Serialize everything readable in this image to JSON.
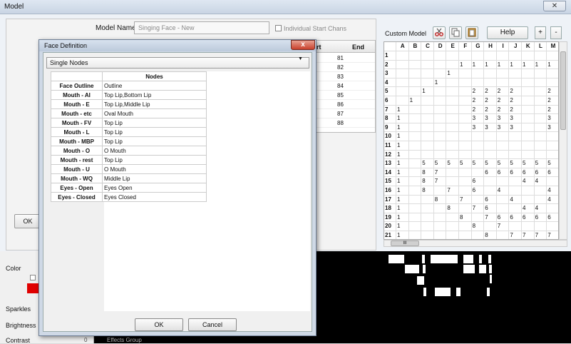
{
  "window": {
    "title": "Model",
    "close_icon": "close-icon"
  },
  "model": {
    "name_label": "Model Name",
    "name_value": "Singing Face - New",
    "individual_start_chans_label": "Individual Start Chans",
    "table_header_start": "art",
    "table_header_end": "End",
    "table_end_values": [
      "81",
      "82",
      "83",
      "84",
      "85",
      "86",
      "87",
      "88"
    ],
    "ok_button_label": "OK"
  },
  "custom_model": {
    "label": "Custom Model",
    "help_label": "Help",
    "plus_label": "+",
    "minus_label": "-",
    "icons": [
      "cut-icon",
      "copy-icon",
      "paste-icon"
    ],
    "columns": [
      "A",
      "B",
      "C",
      "D",
      "E",
      "F",
      "G",
      "H",
      "I",
      "J",
      "K",
      "L",
      "M"
    ],
    "rows": [
      {
        "n": "1",
        "cells": [
          "",
          "",
          "",
          "",
          "",
          "",
          "",
          "",
          "",
          "",
          "",
          "",
          ""
        ]
      },
      {
        "n": "2",
        "cells": [
          "",
          "",
          "",
          "",
          "",
          "1",
          "1",
          "1",
          "1",
          "1",
          "1",
          "1",
          "1"
        ]
      },
      {
        "n": "3",
        "cells": [
          "",
          "",
          "",
          "",
          "1",
          "",
          "",
          "",
          "",
          "",
          "",
          "",
          ""
        ]
      },
      {
        "n": "4",
        "cells": [
          "",
          "",
          "",
          "1",
          "",
          "",
          "",
          "",
          "",
          "",
          "",
          "",
          ""
        ]
      },
      {
        "n": "5",
        "cells": [
          "",
          "",
          "1",
          "",
          "",
          "",
          "2",
          "2",
          "2",
          "2",
          "",
          "",
          "2"
        ]
      },
      {
        "n": "6",
        "cells": [
          "",
          "1",
          "",
          "",
          "",
          "",
          "2",
          "2",
          "2",
          "2",
          "",
          "",
          "2"
        ]
      },
      {
        "n": "7",
        "cells": [
          "1",
          "",
          "",
          "",
          "",
          "",
          "2",
          "2",
          "2",
          "2",
          "",
          "",
          "2"
        ]
      },
      {
        "n": "8",
        "cells": [
          "1",
          "",
          "",
          "",
          "",
          "",
          "3",
          "3",
          "3",
          "3",
          "",
          "",
          "3"
        ]
      },
      {
        "n": "9",
        "cells": [
          "1",
          "",
          "",
          "",
          "",
          "",
          "3",
          "3",
          "3",
          "3",
          "",
          "",
          "3"
        ]
      },
      {
        "n": "10",
        "cells": [
          "1",
          "",
          "",
          "",
          "",
          "",
          "",
          "",
          "",
          "",
          "",
          "",
          ""
        ]
      },
      {
        "n": "11",
        "cells": [
          "1",
          "",
          "",
          "",
          "",
          "",
          "",
          "",
          "",
          "",
          "",
          "",
          ""
        ]
      },
      {
        "n": "12",
        "cells": [
          "1",
          "",
          "",
          "",
          "",
          "",
          "",
          "",
          "",
          "",
          "",
          "",
          ""
        ]
      },
      {
        "n": "13",
        "cells": [
          "1",
          "",
          "5",
          "5",
          "5",
          "5",
          "5",
          "5",
          "5",
          "5",
          "5",
          "5",
          "5"
        ]
      },
      {
        "n": "14",
        "cells": [
          "1",
          "",
          "8",
          "7",
          "",
          "",
          "",
          "6",
          "6",
          "6",
          "6",
          "6",
          "6"
        ]
      },
      {
        "n": "15",
        "cells": [
          "1",
          "",
          "8",
          "7",
          "",
          "",
          "6",
          "",
          "",
          "",
          "4",
          "4",
          ""
        ]
      },
      {
        "n": "16",
        "cells": [
          "1",
          "",
          "8",
          "",
          "7",
          "",
          "6",
          "",
          "4",
          "",
          "",
          "",
          "4"
        ]
      },
      {
        "n": "17",
        "cells": [
          "1",
          "",
          "",
          "8",
          "",
          "7",
          "",
          "6",
          "",
          "4",
          "",
          "",
          "4"
        ]
      },
      {
        "n": "18",
        "cells": [
          "1",
          "",
          "",
          "",
          "8",
          "",
          "7",
          "6",
          "",
          "",
          "4",
          "4",
          ""
        ]
      },
      {
        "n": "19",
        "cells": [
          "1",
          "",
          "",
          "",
          "",
          "8",
          "",
          "7",
          "6",
          "6",
          "6",
          "6",
          "6"
        ]
      },
      {
        "n": "20",
        "cells": [
          "1",
          "",
          "",
          "",
          "",
          "",
          "8",
          "",
          "7",
          "",
          "",
          "",
          ""
        ]
      },
      {
        "n": "21",
        "cells": [
          "1",
          "",
          "",
          "",
          "",
          "",
          "",
          "8",
          "",
          "7",
          "7",
          "7",
          "7"
        ]
      }
    ],
    "hscroll_thumb": "III"
  },
  "left_panel": {
    "color_label": "Color",
    "sparkles_label": "Sparkles",
    "brightness_label": "Brightness",
    "contrast_label": "Contrast",
    "swatch_color": "#e00000",
    "effects_number": "0",
    "effects_label": "Effects Group"
  },
  "face_dialog": {
    "title": "Face Definition",
    "close_label": "x",
    "select_value": "Single Nodes",
    "nodes_header": "Nodes",
    "rows": [
      {
        "name": "Face Outline",
        "nodes": "Outline"
      },
      {
        "name": "Mouth - AI",
        "nodes": "Top Lip,Bottom Lip"
      },
      {
        "name": "Mouth - E",
        "nodes": "Top Lip,Middle Lip"
      },
      {
        "name": "Mouth - etc",
        "nodes": "Oval Mouth"
      },
      {
        "name": "Mouth - FV",
        "nodes": "Top Lip"
      },
      {
        "name": "Mouth - L",
        "nodes": "Top Lip"
      },
      {
        "name": "Mouth - MBP",
        "nodes": "Top Lip"
      },
      {
        "name": "Mouth - O",
        "nodes": "O Mouth"
      },
      {
        "name": "Mouth - rest",
        "nodes": "Top Lip"
      },
      {
        "name": "Mouth - U",
        "nodes": "O Mouth"
      },
      {
        "name": "Mouth - WQ",
        "nodes": "Middle Lip"
      },
      {
        "name": "Eyes - Open",
        "nodes": "Eyes Open"
      },
      {
        "name": "Eyes - Closed",
        "nodes": "Eyes Closed"
      }
    ],
    "ok_label": "OK",
    "cancel_label": "Cancel"
  }
}
